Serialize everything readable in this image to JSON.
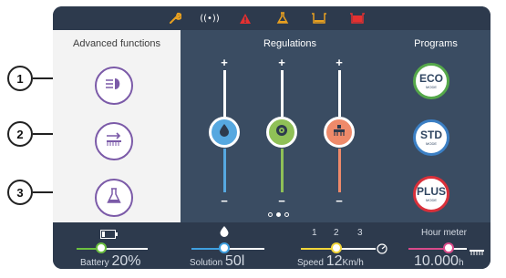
{
  "callouts": [
    "1",
    "2",
    "3"
  ],
  "status_icons": [
    {
      "name": "wrench-icon",
      "color": "#e8a020"
    },
    {
      "name": "wireless-icon",
      "color": "#ffffff",
      "glyph": "((•))"
    },
    {
      "name": "warning-icon",
      "color": "#e53030"
    },
    {
      "name": "flask-warning-icon",
      "color": "#e8a020"
    },
    {
      "name": "tank-icon",
      "color": "#e8a020"
    },
    {
      "name": "tank-full-icon",
      "color": "#e53030"
    }
  ],
  "advanced_functions": {
    "title": "Advanced functions",
    "buttons": [
      {
        "name": "headlight-button",
        "icon": "headlight-icon"
      },
      {
        "name": "brush-button",
        "icon": "brush-arrow-icon"
      },
      {
        "name": "detergent-button",
        "icon": "flask-icon"
      }
    ]
  },
  "regulations": {
    "title": "Regulations",
    "plus": "+",
    "minus": "−",
    "sliders": [
      {
        "name": "water-regulation",
        "icon": "water-drop-icon",
        "color": "#56a8e0",
        "level": 0.5
      },
      {
        "name": "pressure-regulation",
        "icon": "brush-pressure-icon",
        "color": "#8fc057",
        "level": 0.5
      },
      {
        "name": "squeegee-regulation",
        "icon": "squeegee-icon",
        "color": "#ef8a6a",
        "level": 0.5
      }
    ]
  },
  "programs": {
    "title": "Programs",
    "items": [
      {
        "name": "ECO",
        "mode": "MODE",
        "color": "#55a84a"
      },
      {
        "name": "STD",
        "mode": "MODE",
        "color": "#3b7fc4"
      },
      {
        "name": "PLUS",
        "mode": "MODE",
        "color": "#d9303a"
      }
    ]
  },
  "pager": {
    "count": 3,
    "active": 1
  },
  "bottom": {
    "battery": {
      "label": "Battery",
      "value": "20",
      "unit": "%",
      "level": 0.2,
      "color": "#6cc040"
    },
    "solution": {
      "label": "Solution",
      "value": "50",
      "unit": "l",
      "level": 0.5,
      "color": "#3fa0e0"
    },
    "speed": {
      "label": "Speed",
      "value": "12",
      "unit": "Km/h",
      "ticks": [
        "1",
        "2",
        "3"
      ],
      "level": 0.5,
      "color": "#f2d63a"
    },
    "hour_meter": {
      "label": "Hour meter",
      "value": "10.000",
      "unit": "h",
      "level": 0.5,
      "color": "#d94a8a"
    }
  }
}
